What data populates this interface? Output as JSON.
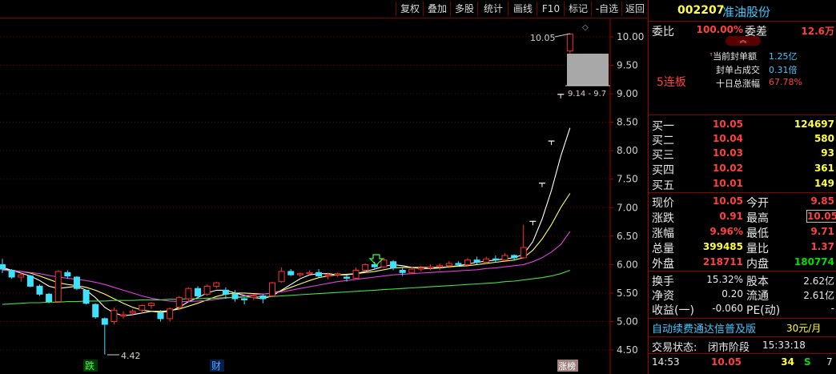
{
  "toolbar": {
    "buttons": [
      "复权",
      "叠加",
      "多股",
      "统计",
      "画线",
      "F10",
      "标记",
      "-自选",
      "返回"
    ]
  },
  "stock": {
    "code": "002207",
    "name": "准油股份"
  },
  "ratio": {
    "weibi_label": "委比",
    "weibi_value": "100.00%",
    "weicha_label": "委差",
    "weicha_value": "12.6万"
  },
  "seal": {
    "amount_label": "当前封单额",
    "amount_value": "1.25亿",
    "ratio_label": "封单占成交",
    "ratio_value": "0.31倍",
    "gain_label": "十日总涨幅",
    "gain_value": "67.78%",
    "streak": "5连板"
  },
  "bids": [
    {
      "label": "买一",
      "price": "10.05",
      "vol": "124697"
    },
    {
      "label": "买二",
      "price": "10.04",
      "vol": "580"
    },
    {
      "label": "买三",
      "price": "10.03",
      "vol": "93"
    },
    {
      "label": "买四",
      "price": "10.02",
      "vol": "361"
    },
    {
      "label": "买五",
      "price": "10.01",
      "vol": "149"
    }
  ],
  "quote": {
    "now_label": "现价",
    "now": "10.05",
    "open_label": "今开",
    "open": "9.85",
    "chg_label": "涨跌",
    "chg": "0.91",
    "high_label": "最高",
    "high": "10.05",
    "pct_label": "涨幅",
    "pct": "9.96%",
    "low_label": "最低",
    "low": "9.71",
    "vol_label": "总量",
    "vol": "399485",
    "lb_label": "量比",
    "lb": "1.37",
    "out_label": "外盘",
    "out": "218711",
    "in_label": "内盘",
    "in": "180774"
  },
  "fund": {
    "turn_label": "换手",
    "turn": "15.32%",
    "cap_label": "股本",
    "cap": "2.62亿",
    "nav_label": "净资",
    "nav": "0.20",
    "float_label": "流通",
    "float": "2.61亿",
    "eps_label": "收益(一)",
    "eps": "-0.060",
    "pe_label": "PE(动)",
    "pe": "-"
  },
  "ad": {
    "text": "自动续费通达信普及版",
    "price": "30元/月"
  },
  "status": {
    "label": "交易状态:",
    "value": "闭市阶段",
    "time": "15:33:18"
  },
  "ticks": [
    {
      "time": "14:53",
      "price": "10.05",
      "vol": "34",
      "bs": "S",
      "n": "7"
    }
  ],
  "chart_labels": {
    "high_mark": "10.05",
    "low_mark": "4.42",
    "range": "9.14 - 9.7",
    "tag_die": "跌",
    "tag_cai": "财",
    "tag_zhangbang": "涨榜"
  },
  "chart_data": {
    "type": "candlestick",
    "yaxis_ticks": [
      "10.00",
      "9.50",
      "9.00",
      "8.50",
      "8.00",
      "7.50",
      "7.00",
      "6.50",
      "6.00",
      "5.50",
      "5.00",
      "4.50"
    ],
    "ylim": [
      4.35,
      10.15
    ],
    "candles": [
      [
        6.0,
        6.1,
        5.85,
        5.92
      ],
      [
        5.9,
        5.92,
        5.75,
        5.78
      ],
      [
        5.78,
        5.85,
        5.7,
        5.82
      ],
      [
        5.8,
        5.82,
        5.6,
        5.62
      ],
      [
        5.62,
        5.65,
        5.45,
        5.48
      ],
      [
        5.48,
        5.5,
        5.32,
        5.35
      ],
      [
        5.35,
        5.9,
        5.33,
        5.88
      ],
      [
        5.86,
        5.9,
        5.75,
        5.8
      ],
      [
        5.78,
        5.8,
        5.55,
        5.58
      ],
      [
        5.55,
        5.56,
        5.3,
        5.32
      ],
      [
        5.3,
        5.32,
        5.05,
        5.08
      ],
      [
        5.05,
        5.07,
        4.42,
        4.95
      ],
      [
        5.0,
        5.25,
        4.95,
        5.2
      ],
      [
        5.1,
        5.18,
        5.05,
        5.12
      ],
      [
        5.15,
        5.22,
        5.1,
        5.18
      ],
      [
        5.2,
        5.3,
        5.15,
        5.28
      ],
      [
        5.28,
        5.34,
        5.22,
        5.32
      ],
      [
        5.15,
        5.2,
        5.0,
        5.05
      ],
      [
        5.05,
        5.25,
        5.0,
        5.22
      ],
      [
        5.25,
        5.45,
        5.2,
        5.42
      ],
      [
        5.4,
        5.6,
        5.36,
        5.58
      ],
      [
        5.58,
        5.62,
        5.4,
        5.45
      ],
      [
        5.48,
        5.65,
        5.45,
        5.62
      ],
      [
        5.62,
        5.7,
        5.58,
        5.68
      ],
      [
        5.55,
        5.6,
        5.4,
        5.48
      ],
      [
        5.48,
        5.55,
        5.35,
        5.4
      ],
      [
        5.4,
        5.42,
        5.3,
        5.38
      ],
      [
        5.42,
        5.48,
        5.38,
        5.45
      ],
      [
        5.45,
        5.48,
        5.32,
        5.4
      ],
      [
        5.45,
        5.7,
        5.43,
        5.68
      ],
      [
        5.7,
        5.95,
        5.68,
        5.88
      ],
      [
        5.88,
        5.92,
        5.8,
        5.82
      ],
      [
        5.82,
        5.86,
        5.78,
        5.84
      ],
      [
        5.84,
        5.9,
        5.82,
        5.86
      ],
      [
        5.86,
        5.92,
        5.78,
        5.8
      ],
      [
        5.8,
        5.86,
        5.74,
        5.82
      ],
      [
        5.82,
        5.86,
        5.78,
        5.84
      ],
      [
        5.78,
        5.82,
        5.7,
        5.76
      ],
      [
        5.76,
        5.95,
        5.74,
        5.9
      ],
      [
        5.9,
        6.02,
        5.88,
        6.0
      ],
      [
        6.0,
        6.05,
        5.92,
        5.96
      ],
      [
        5.96,
        6.12,
        5.94,
        6.08
      ],
      [
        6.05,
        6.08,
        5.9,
        5.94
      ],
      [
        5.9,
        5.94,
        5.8,
        5.86
      ],
      [
        5.86,
        5.96,
        5.84,
        5.92
      ],
      [
        5.92,
        5.98,
        5.88,
        5.94
      ],
      [
        5.94,
        6.0,
        5.9,
        5.96
      ],
      [
        5.96,
        6.02,
        5.9,
        5.98
      ],
      [
        5.98,
        6.06,
        5.94,
        6.02
      ],
      [
        6.02,
        6.06,
        5.96,
        6.0
      ],
      [
        6.0,
        6.12,
        5.98,
        6.08
      ],
      [
        6.08,
        6.14,
        6.0,
        6.04
      ],
      [
        6.04,
        6.14,
        6.02,
        6.1
      ],
      [
        6.1,
        6.16,
        6.04,
        6.08
      ],
      [
        6.08,
        6.2,
        6.06,
        6.16
      ],
      [
        6.16,
        6.18,
        6.08,
        6.12
      ],
      [
        6.12,
        6.7,
        6.1,
        6.3
      ],
      [
        6.76,
        6.76,
        6.76,
        6.76
      ],
      [
        7.43,
        7.43,
        7.43,
        7.43
      ],
      [
        8.17,
        8.17,
        8.17,
        8.17
      ],
      [
        8.99,
        8.99,
        8.99,
        8.99
      ],
      [
        9.75,
        10.05,
        9.71,
        10.05
      ]
    ],
    "ma_lines": [
      {
        "color": "#ffffff",
        "values": [
          5.95,
          5.9,
          5.85,
          5.8,
          5.72,
          5.62,
          5.58,
          5.6,
          5.62,
          5.55,
          5.42,
          5.25,
          5.15,
          5.1,
          5.12,
          5.15,
          5.18,
          5.16,
          5.18,
          5.25,
          5.35,
          5.42,
          5.5,
          5.55,
          5.55,
          5.5,
          5.46,
          5.42,
          5.4,
          5.45,
          5.55,
          5.65,
          5.75,
          5.82,
          5.84,
          5.84,
          5.82,
          5.82,
          5.84,
          5.88,
          5.92,
          5.97,
          6.0,
          5.98,
          5.95,
          5.93,
          5.93,
          5.94,
          5.96,
          5.98,
          6.01,
          6.04,
          6.06,
          6.08,
          6.1,
          6.12,
          6.18,
          6.4,
          6.8,
          7.3,
          7.9,
          8.4
        ]
      },
      {
        "color": "#ffff60",
        "values": [
          5.92,
          5.9,
          5.88,
          5.85,
          5.8,
          5.74,
          5.68,
          5.65,
          5.63,
          5.6,
          5.55,
          5.48,
          5.4,
          5.32,
          5.25,
          5.2,
          5.18,
          5.18,
          5.19,
          5.22,
          5.27,
          5.32,
          5.38,
          5.44,
          5.48,
          5.5,
          5.5,
          5.49,
          5.48,
          5.5,
          5.54,
          5.6,
          5.66,
          5.72,
          5.77,
          5.8,
          5.82,
          5.83,
          5.84,
          5.86,
          5.88,
          5.91,
          5.94,
          5.95,
          5.95,
          5.95,
          5.95,
          5.95,
          5.96,
          5.97,
          5.98,
          6.0,
          6.02,
          6.04,
          6.06,
          6.08,
          6.12,
          6.25,
          6.45,
          6.7,
          7.0,
          7.25
        ]
      },
      {
        "color": "#e040e0",
        "values": [
          5.9,
          5.89,
          5.88,
          5.86,
          5.84,
          5.81,
          5.78,
          5.76,
          5.74,
          5.72,
          5.69,
          5.65,
          5.6,
          5.55,
          5.5,
          5.45,
          5.41,
          5.38,
          5.36,
          5.35,
          5.35,
          5.36,
          5.37,
          5.39,
          5.41,
          5.43,
          5.45,
          5.47,
          5.48,
          5.5,
          5.52,
          5.55,
          5.58,
          5.61,
          5.64,
          5.67,
          5.7,
          5.72,
          5.74,
          5.76,
          5.78,
          5.8,
          5.82,
          5.83,
          5.84,
          5.85,
          5.86,
          5.87,
          5.88,
          5.89,
          5.9,
          5.91,
          5.93,
          5.94,
          5.96,
          5.98,
          6.0,
          6.05,
          6.12,
          6.22,
          6.35,
          6.58
        ]
      },
      {
        "color": "#40e040",
        "values": [
          5.3,
          5.31,
          5.32,
          5.33,
          5.33,
          5.34,
          5.34,
          5.35,
          5.35,
          5.36,
          5.36,
          5.36,
          5.37,
          5.37,
          5.37,
          5.38,
          5.38,
          5.38,
          5.39,
          5.39,
          5.4,
          5.4,
          5.41,
          5.41,
          5.42,
          5.42,
          5.43,
          5.43,
          5.44,
          5.44,
          5.45,
          5.46,
          5.47,
          5.48,
          5.49,
          5.5,
          5.51,
          5.52,
          5.53,
          5.54,
          5.55,
          5.56,
          5.57,
          5.58,
          5.59,
          5.6,
          5.61,
          5.62,
          5.63,
          5.64,
          5.65,
          5.66,
          5.67,
          5.68,
          5.7,
          5.71,
          5.73,
          5.75,
          5.77,
          5.8,
          5.84,
          5.9
        ]
      }
    ]
  }
}
